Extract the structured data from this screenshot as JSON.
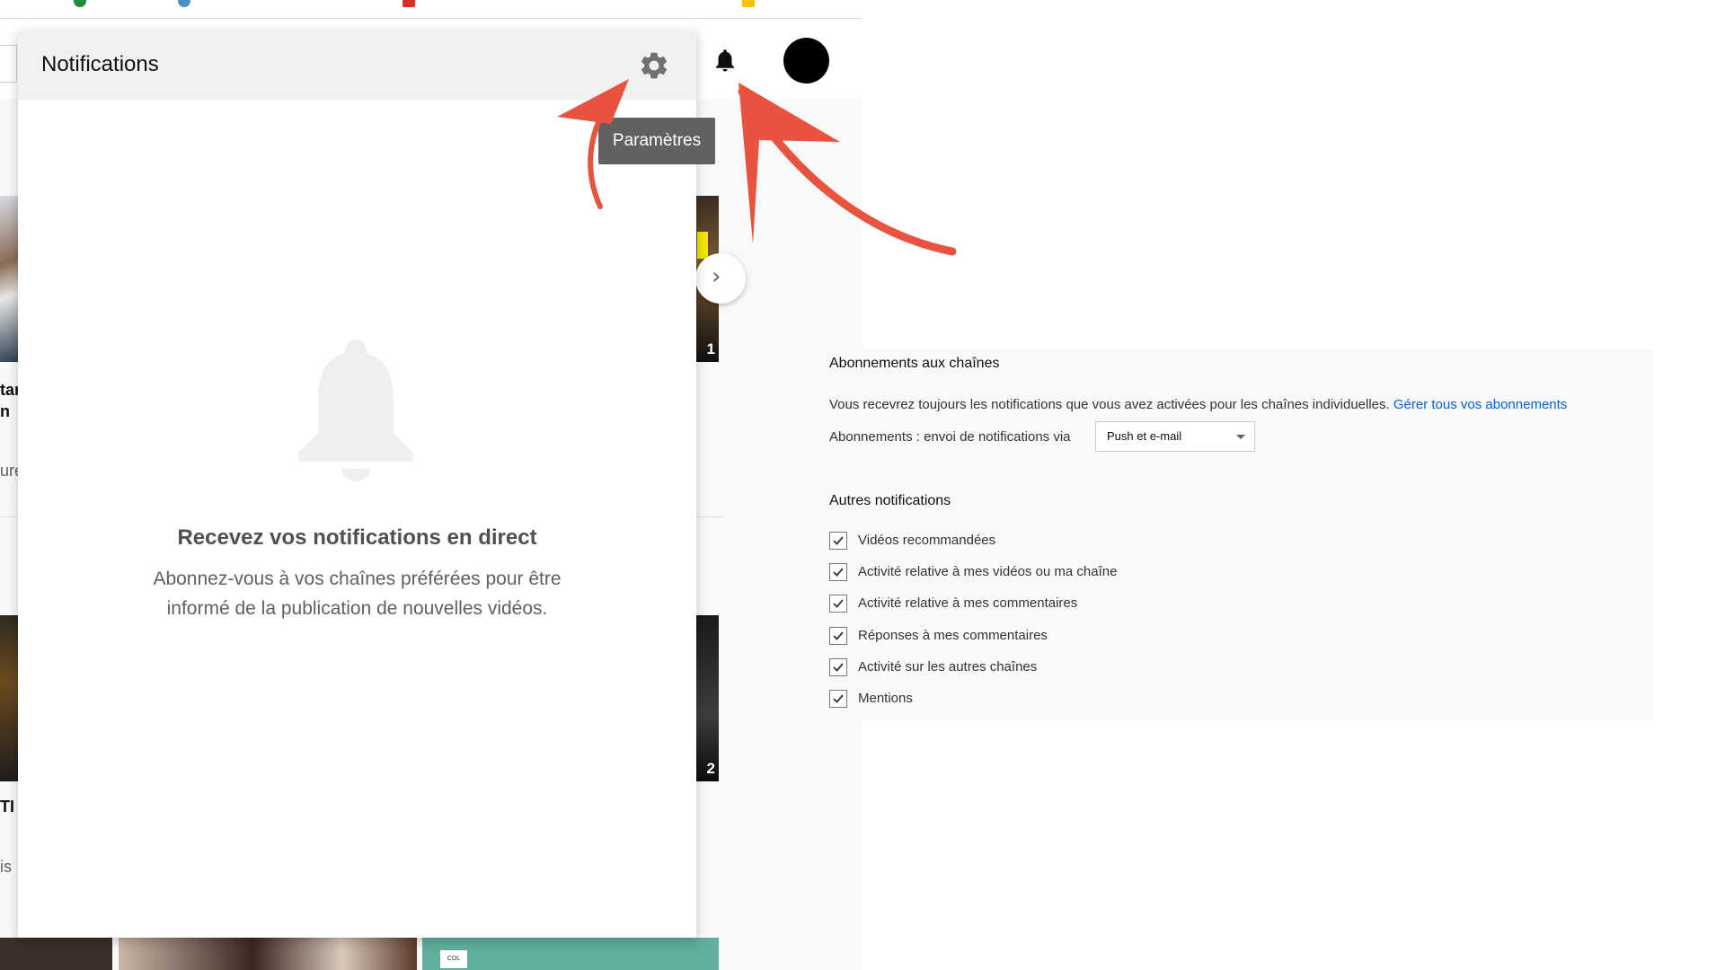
{
  "notifications_panel": {
    "title": "Notifications",
    "empty_title": "Recevez vos notifications en direct",
    "empty_description": "Abonnez-vous à vos chaînes préférées pour être informé de la publication de nouvelles vidéos."
  },
  "tooltip": {
    "label": "Paramètres"
  },
  "header": {
    "icons": [
      "bell-icon",
      "avatar"
    ]
  },
  "background_fragments": {
    "row1_title": "tar\nn",
    "row1_meta": "ure",
    "row2_title": "TI",
    "row2_meta": "is",
    "thumb_num_1": "1",
    "thumb_num_2": "2",
    "bottom_tag": "COL"
  },
  "settings": {
    "subscriptions_heading": "Abonnements aux chaînes",
    "subscriptions_text": "Vous recevrez toujours les notifications que vous avez activées pour les chaînes individuelles.",
    "manage_link": "Gérer tous vos abonnements",
    "via_label": "Abonnements : envoi de notifications via",
    "via_value": "Push et e-mail",
    "other_heading": "Autres notifications",
    "options": [
      {
        "label": "Vidéos recommandées",
        "checked": true
      },
      {
        "label": "Activité relative à mes vidéos ou ma chaîne",
        "checked": true
      },
      {
        "label": "Activité relative à mes commentaires",
        "checked": true
      },
      {
        "label": "Réponses à mes commentaires",
        "checked": true
      },
      {
        "label": "Activité sur les autres chaînes",
        "checked": true
      },
      {
        "label": "Mentions",
        "checked": true
      }
    ]
  },
  "colors": {
    "annotation_arrow": "#e8533f",
    "link": "#065fd4",
    "tooltip_bg": "#616161"
  }
}
